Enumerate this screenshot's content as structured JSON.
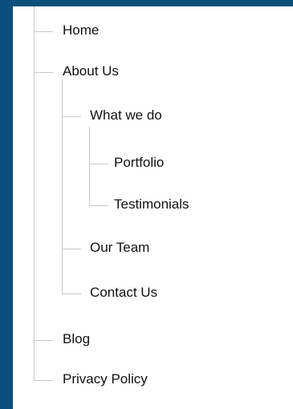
{
  "menu": {
    "items": [
      {
        "label": "Home"
      },
      {
        "label": "About Us"
      },
      {
        "label": "What we do"
      },
      {
        "label": "Portfolio"
      },
      {
        "label": "Testimonials"
      },
      {
        "label": "Our Team"
      },
      {
        "label": "Contact Us"
      },
      {
        "label": "Blog"
      },
      {
        "label": "Privacy Policy"
      }
    ]
  },
  "colors": {
    "background": "#0b4f7c",
    "panel": "#ffffff",
    "tree_line": "#c8c8c8",
    "text": "#111111"
  }
}
